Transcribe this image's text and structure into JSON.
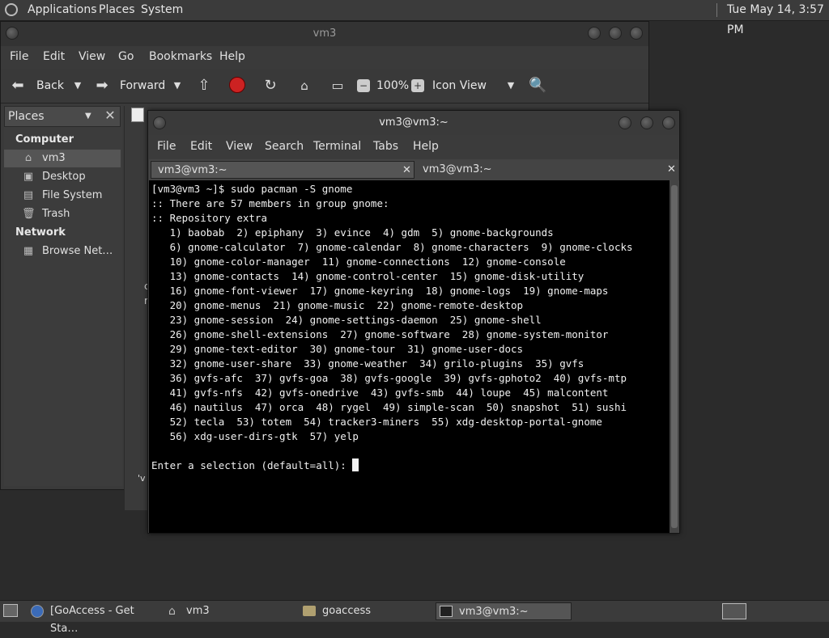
{
  "top_panel": {
    "menus": [
      "Applications",
      "Places",
      "System"
    ],
    "clock": "Tue May 14,  3:57 PM"
  },
  "file_manager": {
    "title": "vm3",
    "menus": [
      "File",
      "Edit",
      "View",
      "Go",
      "Bookmarks",
      "Help"
    ],
    "toolbar": {
      "back": "Back",
      "forward": "Forward",
      "zoom": "100%",
      "view_mode": "Icon View"
    },
    "sidebar": {
      "selector": "Places",
      "sections": [
        {
          "heading": "Computer",
          "items": [
            "vm3",
            "Desktop",
            "File System",
            "Trash"
          ]
        },
        {
          "heading": "Network",
          "items": [
            "Browse Net…"
          ]
        }
      ]
    },
    "content_fragments": [
      "c",
      "r",
      "'v"
    ]
  },
  "terminal": {
    "title": "vm3@vm3:~",
    "menus": [
      "File",
      "Edit",
      "View",
      "Search",
      "Terminal",
      "Tabs",
      "Help"
    ],
    "tabs": [
      "vm3@vm3:~",
      "vm3@vm3:~"
    ],
    "lines": [
      "[vm3@vm3 ~]$ sudo pacman -S gnome",
      ":: There are 57 members in group gnome:",
      ":: Repository extra",
      "   1) baobab  2) epiphany  3) evince  4) gdm  5) gnome-backgrounds",
      "   6) gnome-calculator  7) gnome-calendar  8) gnome-characters  9) gnome-clocks",
      "   10) gnome-color-manager  11) gnome-connections  12) gnome-console",
      "   13) gnome-contacts  14) gnome-control-center  15) gnome-disk-utility",
      "   16) gnome-font-viewer  17) gnome-keyring  18) gnome-logs  19) gnome-maps",
      "   20) gnome-menus  21) gnome-music  22) gnome-remote-desktop",
      "   23) gnome-session  24) gnome-settings-daemon  25) gnome-shell",
      "   26) gnome-shell-extensions  27) gnome-software  28) gnome-system-monitor",
      "   29) gnome-text-editor  30) gnome-tour  31) gnome-user-docs",
      "   32) gnome-user-share  33) gnome-weather  34) grilo-plugins  35) gvfs",
      "   36) gvfs-afc  37) gvfs-goa  38) gvfs-google  39) gvfs-gphoto2  40) gvfs-mtp",
      "   41) gvfs-nfs  42) gvfs-onedrive  43) gvfs-smb  44) loupe  45) malcontent",
      "   46) nautilus  47) orca  48) rygel  49) simple-scan  50) snapshot  51) sushi",
      "   52) tecla  53) totem  54) tracker3-miners  55) xdg-desktop-portal-gnome",
      "   56) xdg-user-dirs-gtk  57) yelp",
      "",
      "Enter a selection (default=all): "
    ]
  },
  "taskbar": {
    "items": [
      "[GoAccess - Get Sta…",
      "vm3",
      "goaccess",
      "vm3@vm3:~"
    ]
  }
}
